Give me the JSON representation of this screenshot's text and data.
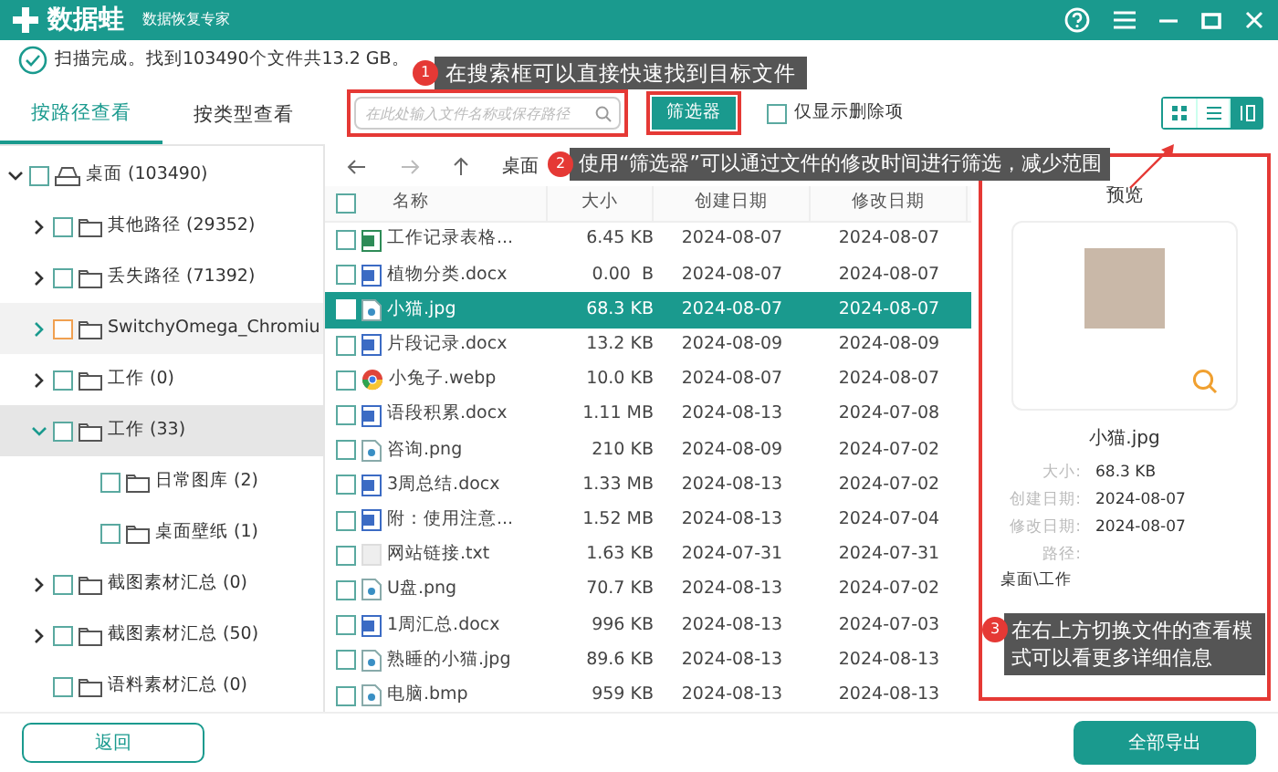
{
  "app": {
    "name": "数据蛙",
    "subtitle": "数据恢复专家"
  },
  "status": "扫描完成。找到103490个文件共13.2 GB。",
  "view_tabs": [
    {
      "label": "按路径查看",
      "selected": true
    },
    {
      "label": "按类型查看",
      "selected": false
    }
  ],
  "search": {
    "placeholder": "在此处输入文件名称或保存路径"
  },
  "filter_button": "筛选器",
  "only_deleted": {
    "label": "仅显示删除项",
    "checked": false
  },
  "view_modes": [
    {
      "kind": "grid",
      "selected": false
    },
    {
      "kind": "list",
      "selected": false
    },
    {
      "kind": "detail",
      "selected": true
    }
  ],
  "breadcrumb": "桌面",
  "tree": [
    {
      "label": "桌面 (103490)",
      "kind": "drive",
      "expanded": true,
      "checked": false,
      "selected": false,
      "hovered": false,
      "focused": false,
      "children": [
        {
          "label": "其他路径 (29352)",
          "expanded": false,
          "checked": false,
          "selected": false,
          "hovered": false,
          "focused": false
        },
        {
          "label": "丢失路径 (71392)",
          "expanded": false,
          "checked": false,
          "selected": false,
          "hovered": false,
          "focused": false
        },
        {
          "label": "SwitchyOmega_Chromiu",
          "expanded": false,
          "checked": false,
          "selected": false,
          "hovered": true,
          "focused": true
        },
        {
          "label": "工作 (0)",
          "expanded": false,
          "checked": false,
          "selected": false,
          "hovered": false,
          "focused": false
        },
        {
          "label": "工作 (33)",
          "expanded": true,
          "checked": false,
          "selected": true,
          "hovered": false,
          "focused": false,
          "children": [
            {
              "label": "日常图库 (2)",
              "checked": false,
              "selected": false,
              "hovered": false,
              "focused": false
            },
            {
              "label": "桌面壁纸 (1)",
              "checked": false,
              "selected": false,
              "hovered": false,
              "focused": false
            }
          ]
        },
        {
          "label": "截图素材汇总 (0)",
          "expanded": false,
          "checked": false,
          "selected": false,
          "hovered": false,
          "focused": false
        },
        {
          "label": "截图素材汇总 (50)",
          "expanded": false,
          "checked": false,
          "selected": false,
          "hovered": false,
          "focused": false
        },
        {
          "label": "语料素材汇总 (0)",
          "checked": false,
          "selected": false,
          "hovered": false,
          "focused": false
        }
      ]
    }
  ],
  "table": {
    "all_checked": false,
    "columns": [
      "名称",
      "大小",
      "创建日期",
      "修改日期"
    ],
    "rows": [
      {
        "kind": "sheet",
        "name": "工作记录表格...",
        "size": "6.45 KB",
        "created": "2024-08-07",
        "modified": "2024-08-07",
        "checked": false,
        "selected": false
      },
      {
        "kind": "doc",
        "name": "植物分类.docx",
        "size": "0.00  B",
        "created": "2024-08-07",
        "modified": "2024-08-07",
        "checked": false,
        "selected": false
      },
      {
        "kind": "image",
        "name": "小猫.jpg",
        "size": "68.3 KB",
        "created": "2024-08-07",
        "modified": "2024-08-07",
        "checked": false,
        "selected": true
      },
      {
        "kind": "doc",
        "name": "片段记录.docx",
        "size": "13.2 KB",
        "created": "2024-08-09",
        "modified": "2024-08-09",
        "checked": false,
        "selected": false
      },
      {
        "kind": "web",
        "name": "小兔子.webp",
        "size": "10.0 KB",
        "created": "2024-08-07",
        "modified": "2024-08-07",
        "checked": false,
        "selected": false
      },
      {
        "kind": "doc",
        "name": "语段积累.docx",
        "size": "1.11 MB",
        "created": "2024-08-13",
        "modified": "2024-07-08",
        "checked": false,
        "selected": false
      },
      {
        "kind": "image",
        "name": "咨询.png",
        "size": "210 KB",
        "created": "2024-08-09",
        "modified": "2024-07-02",
        "checked": false,
        "selected": false
      },
      {
        "kind": "doc",
        "name": "3周总结.docx",
        "size": "1.33 MB",
        "created": "2024-08-13",
        "modified": "2024-07-02",
        "checked": false,
        "selected": false
      },
      {
        "kind": "doc",
        "name": "附：使用注意...",
        "size": "1.52 MB",
        "created": "2024-08-13",
        "modified": "2024-07-04",
        "checked": false,
        "selected": false
      },
      {
        "kind": "text",
        "name": "网站链接.txt",
        "size": "1.63 KB",
        "created": "2024-07-31",
        "modified": "2024-07-31",
        "checked": false,
        "selected": false
      },
      {
        "kind": "image",
        "name": "U盘.png",
        "size": "70.7 KB",
        "created": "2024-08-13",
        "modified": "2024-07-02",
        "checked": false,
        "selected": false
      },
      {
        "kind": "doc",
        "name": "1周汇总.docx",
        "size": "996 KB",
        "created": "2024-08-13",
        "modified": "2024-07-03",
        "checked": false,
        "selected": false
      },
      {
        "kind": "image",
        "name": "熟睡的小猫.jpg",
        "size": "89.6 KB",
        "created": "2024-08-13",
        "modified": "2024-08-13",
        "checked": false,
        "selected": false
      },
      {
        "kind": "image",
        "name": "电脑.bmp",
        "size": "959 KB",
        "created": "2024-08-13",
        "modified": "2024-08-13",
        "checked": false,
        "selected": false
      }
    ]
  },
  "preview": {
    "title": "预览",
    "file_name": "小猫.jpg",
    "details": [
      {
        "label": "大小:",
        "value": "68.3 KB"
      },
      {
        "label": "创建日期:",
        "value": "2024-08-07"
      },
      {
        "label": "修改日期:",
        "value": "2024-08-07"
      },
      {
        "label": "路径:"
      }
    ],
    "path": "桌面\\工作"
  },
  "back_button": "返回",
  "export_button": "全部导出",
  "callouts": [
    {
      "number": "1",
      "text": "在搜索框可以直接快速找到目标文件"
    },
    {
      "number": "2",
      "text": "使用“筛选器”可以通过文件的修改时间进行筛选，减少范围"
    },
    {
      "number": "3",
      "text": "在右上方切换文件的查看模式可以看更多详细信息"
    }
  ]
}
